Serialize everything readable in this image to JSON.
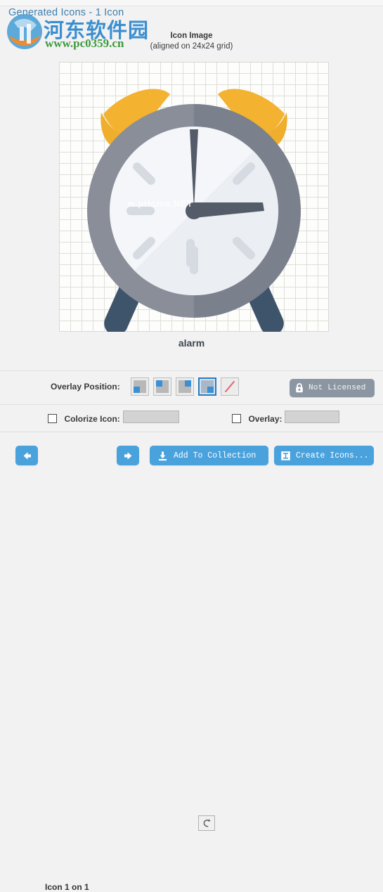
{
  "window": {
    "title": "Generated Icons - 1 Icon",
    "title_color": "#3f7fb0"
  },
  "preview": {
    "header_title": "Icon Image",
    "header_subtitle": "(aligned on 24x24 grid)",
    "grid_label": "24x24",
    "icon_caption": "alarm",
    "icon_name": "alarm-clock-illustration",
    "colors": {
      "bell": "#f3b22f",
      "bell_shadow": "#e8a42a",
      "ring": "#8a8e99",
      "ring_shadow": "#6d7481",
      "face": "#f4f6f9",
      "face_shadow": "#e6e9ef",
      "hands": "#545c69",
      "ticks": "#d6dae1",
      "legs": "#3d546b"
    }
  },
  "overlay_section": {
    "label": "Overlay Position:",
    "selected_index": 3,
    "options": [
      {
        "name": "overlay-position-bottom-left",
        "corner": "bl"
      },
      {
        "name": "overlay-position-top-left",
        "corner": "tl"
      },
      {
        "name": "overlay-position-bottom-right",
        "corner": "br"
      },
      {
        "name": "overlay-position-bottom-right-selected",
        "corner": "br"
      },
      {
        "name": "overlay-position-none",
        "corner": "none"
      }
    ]
  },
  "license": {
    "label": "Not Licensed",
    "icon": "lock-icon",
    "color": "#8c96a3"
  },
  "colorize_row": {
    "colorize_label": "Colorize Icon:",
    "colorize_checked": false,
    "colorize_swatch_color": "#d3d3d3",
    "link_button_icon": "link-loop-icon",
    "overlay_label": "Overlay:",
    "overlay_checked": false,
    "overlay_swatch_color": "#d3d3d3"
  },
  "bottom_bar": {
    "prev_icon": "arrow-left-icon",
    "next_icon": "arrow-right-icon",
    "pager_text": "Icon 1 on 1",
    "add_to_collection_label": "Add To Collection",
    "add_to_collection_icon": "download-icon",
    "create_icons_label": "Create Icons...",
    "create_icons_icon": "text-tool-icon",
    "button_color": "#4aa2dd"
  },
  "watermark": {
    "site_cn": "河东软件园",
    "site_url": "www.pc0359.cn",
    "inline_text": "w.pHome.NET"
  }
}
